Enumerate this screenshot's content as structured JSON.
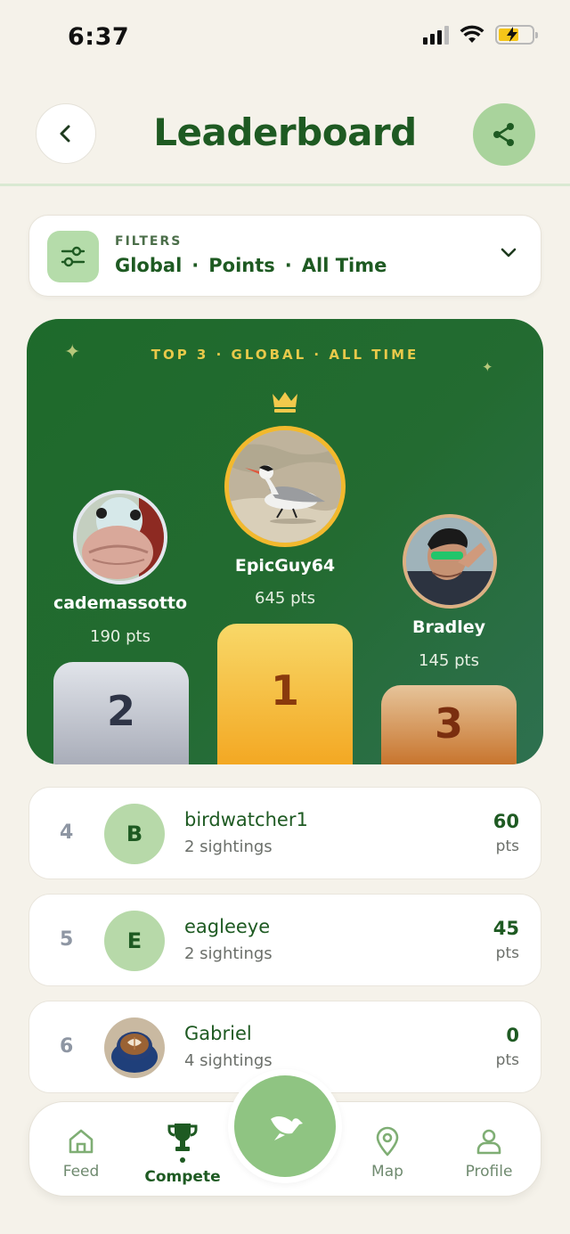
{
  "status": {
    "time": "6:37"
  },
  "header": {
    "title": "Leaderboard"
  },
  "filters": {
    "caption": "FILTERS",
    "scope": "Global",
    "metric": "Points",
    "period": "All Time",
    "separator": "·"
  },
  "podium": {
    "title": "TOP 3 · GLOBAL · ALL TIME",
    "first": {
      "name": "EpicGuy64",
      "points": "645 pts",
      "place": "1"
    },
    "second": {
      "name": "cademassotto",
      "points": "190 pts",
      "place": "2"
    },
    "third": {
      "name": "Bradley",
      "points": "145 pts",
      "place": "3"
    }
  },
  "leaderboard": [
    {
      "rank": "4",
      "initial": "B",
      "name": "birdwatcher1",
      "sightings": "2 sightings",
      "points": "60",
      "unit": "pts"
    },
    {
      "rank": "5",
      "initial": "E",
      "name": "eagleeye",
      "sightings": "2 sightings",
      "points": "45",
      "unit": "pts"
    },
    {
      "rank": "6",
      "initial": "",
      "name": "Gabriel",
      "sightings": "4 sightings",
      "points": "0",
      "unit": "pts"
    }
  ],
  "nav": {
    "feed": "Feed",
    "compete": "Compete",
    "map": "Map",
    "profile": "Profile"
  },
  "colors": {
    "brand_green": "#1e5a22",
    "accent_green": "#a9d39c",
    "gold": "#e8c94a",
    "background": "#f5f2ea"
  }
}
